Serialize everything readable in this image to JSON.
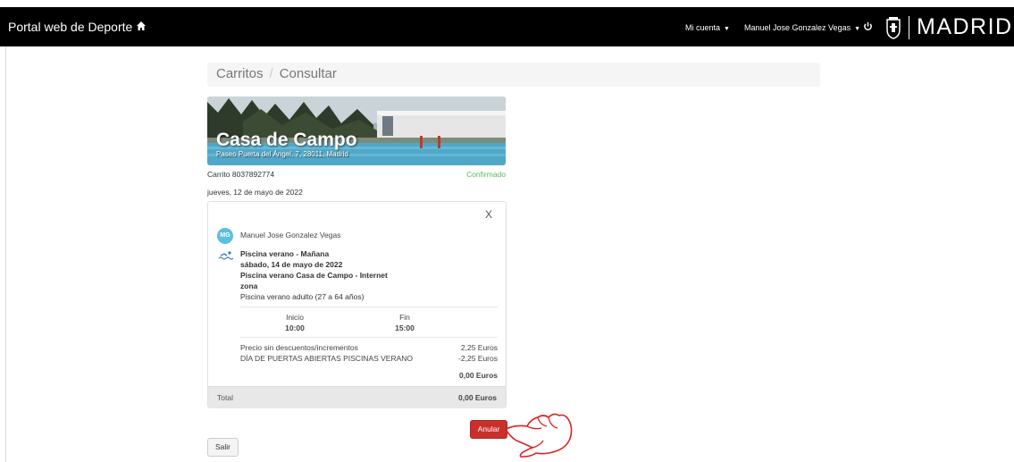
{
  "header": {
    "app_title": "Portal web de Deporte",
    "account_menu": "Mi cuenta",
    "user_menu": "Manuel Jose Gonzalez Vegas",
    "logo_text": "MADRID"
  },
  "breadcrumb": {
    "items": [
      "Carritos",
      "Consultar"
    ],
    "separator": "/"
  },
  "venue": {
    "name": "Casa de Campo",
    "address": "Paseo Puerta del Ángel, 7, 28011, Madrid"
  },
  "cart": {
    "id_label": "Carrito 8037892774",
    "status": "Confirmado",
    "date": "jueves, 12 de mayo de 2022"
  },
  "booking": {
    "close_label": "X",
    "avatar_initials": "MG",
    "member_name": "Manuel Jose Gonzalez Vegas",
    "activity": "Piscina verano - Mañana",
    "activity_date": "sábado, 14 de mayo de 2022",
    "facility": "Piscina verano Casa de Campo - Internet",
    "zone": "zona",
    "rate": "Piscina verano adulto (27 a 64 años)",
    "start_label": "Inicio",
    "start_time": "10:00",
    "end_label": "Fin",
    "end_time": "15:00",
    "lines": [
      {
        "concept": "Precio sin descuentos/incrementos",
        "amount": "2,25 Euros"
      },
      {
        "concept": "DÍA DE PUERTAS ABIERTAS PISCINAS VERANO",
        "amount": "-2,25 Euros"
      }
    ],
    "subtotal": "0,00 Euros",
    "total_label": "Total",
    "total_amount": "0,00 Euros"
  },
  "actions": {
    "cancel_label": "Anular",
    "exit_label": "Salir"
  },
  "colors": {
    "topbar": "#000000",
    "status_green": "#5cb85c",
    "cancel_red": "#c9302c",
    "avatar_blue": "#5bc0de",
    "annotation_red": "#e02020"
  },
  "icons": [
    "home-icon",
    "power-icon",
    "madrid-crest-icon",
    "swim-icon",
    "pointing-hand-annotation"
  ]
}
